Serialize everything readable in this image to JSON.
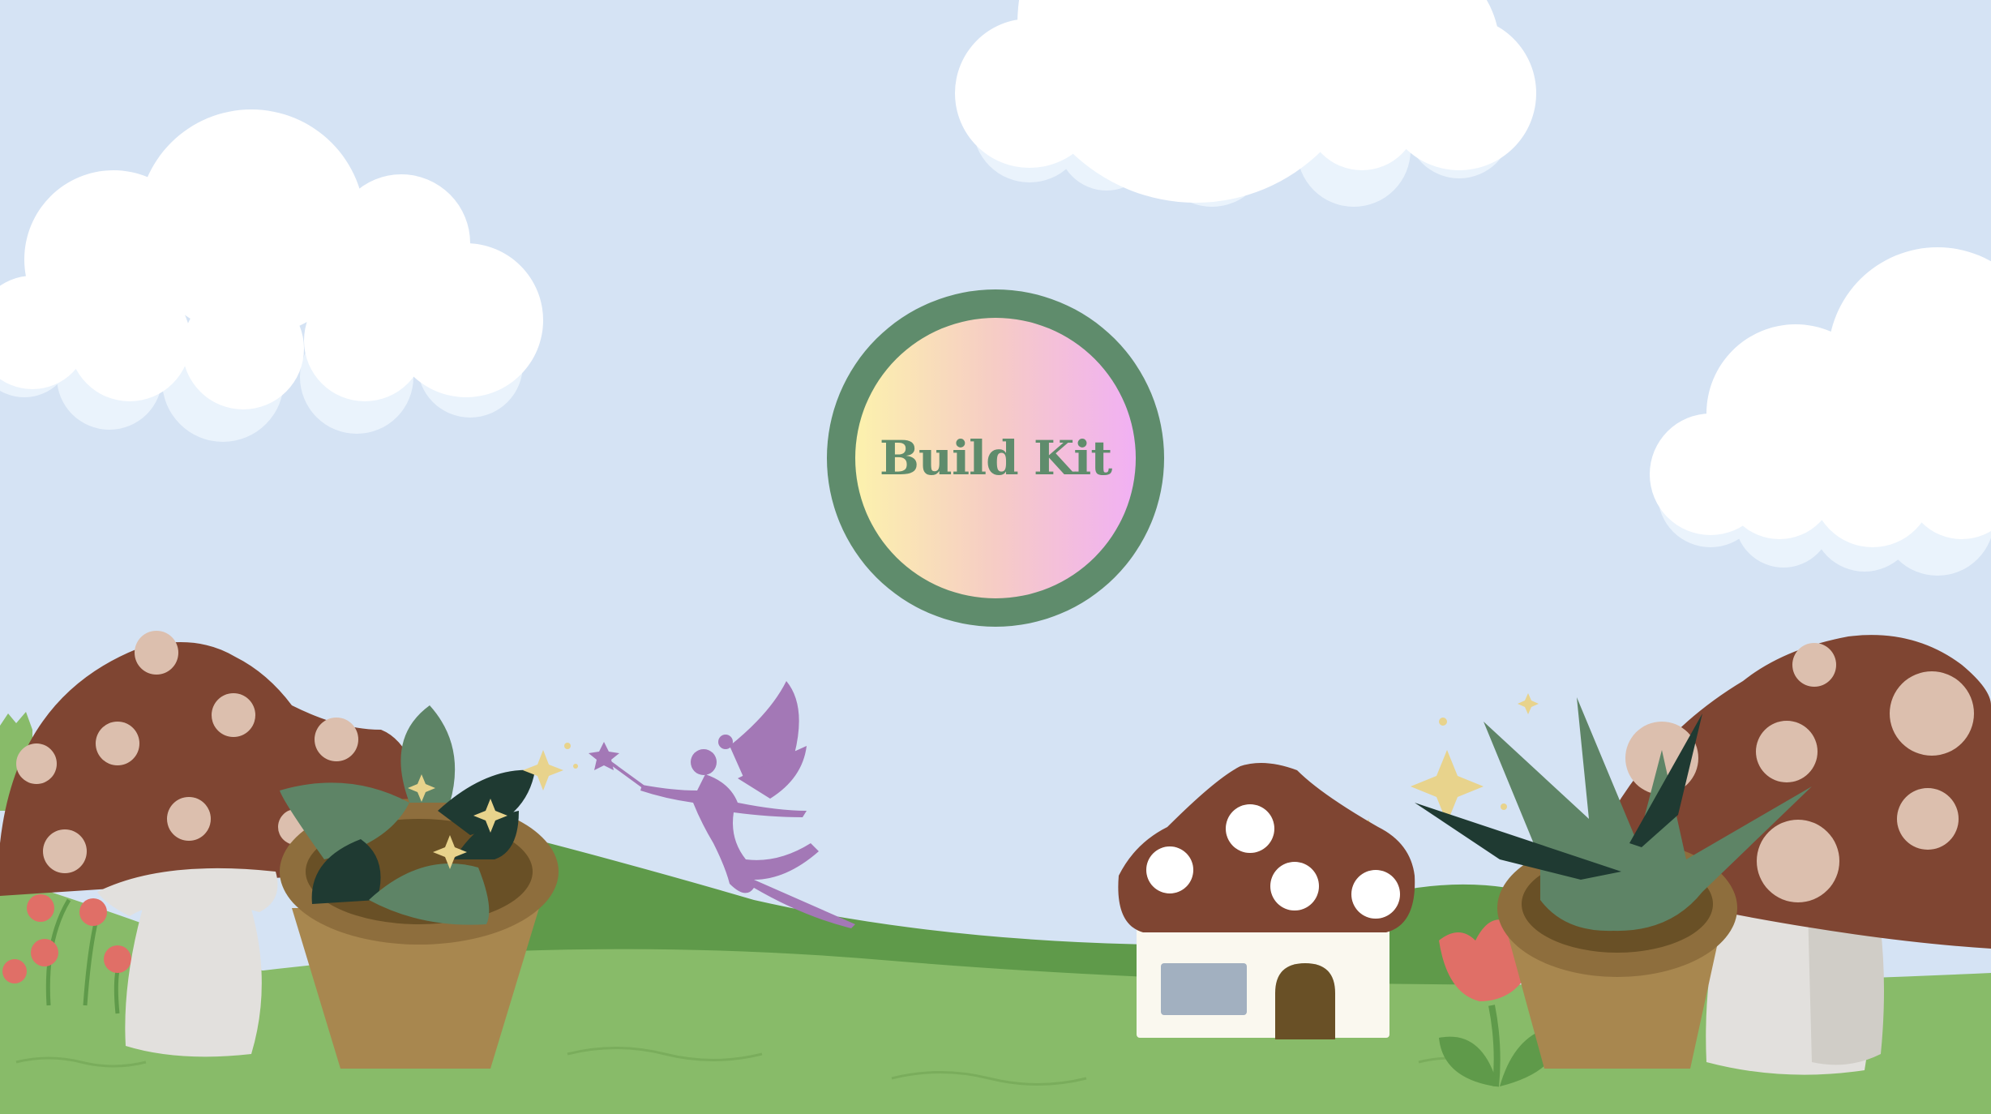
{
  "build_kit": {
    "label": "Build Kit"
  },
  "colors": {
    "sky": "#d5e3f4",
    "grass_light": "#88bb69",
    "grass_dark": "#5f9a4a",
    "mushroom_cap": "#7f4532",
    "mushroom_spot": "#dcbfae",
    "button_ring": "#5f8c6c",
    "fairy": "#a378b6",
    "pot": "#a8874f"
  },
  "icons": [
    "cloud-icon",
    "mushroom-icon",
    "potted-plant-icon",
    "fairy-icon",
    "mushroom-house-icon",
    "tulip-icon",
    "agave-icon",
    "sparkle-icon"
  ]
}
